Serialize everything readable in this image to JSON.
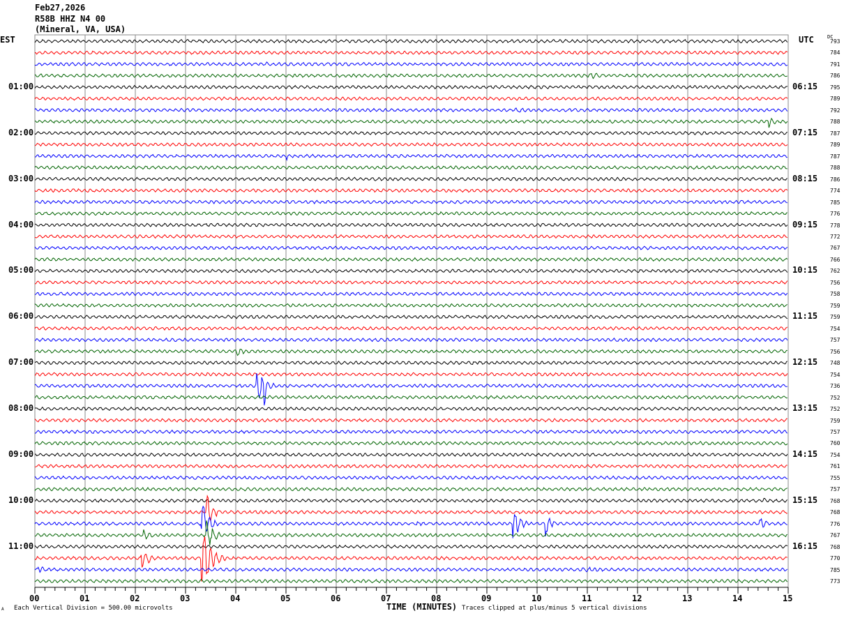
{
  "header": {
    "date": "Feb27,2026",
    "station": "R58B HHZ N4 00",
    "location": "(Mineral, VA, USA)"
  },
  "left_zone": "EST",
  "right_zone": "UTC",
  "dc_label": "DC",
  "footer": {
    "division": "Each Vertical Division =  500.00 microvolts",
    "xlabel": "TIME (MINUTES)",
    "clip": "Traces clipped at plus/minus 5 vertical divisions",
    "corner": "A"
  },
  "chart_data": {
    "type": "line",
    "title": "R58B HHZ N4 00 helicorder",
    "xlabel": "TIME (MINUTES)",
    "xlim": [
      0,
      15
    ],
    "x_ticks": [
      "00",
      "01",
      "02",
      "03",
      "04",
      "05",
      "06",
      "07",
      "08",
      "09",
      "10",
      "11",
      "12",
      "13",
      "14",
      "15"
    ],
    "trace_colors": [
      "#000000",
      "#ff0000",
      "#0000ff",
      "#006400"
    ],
    "trace_count": 48,
    "est_labels": [
      {
        "trace": 4,
        "text": "01:00"
      },
      {
        "trace": 8,
        "text": "02:00"
      },
      {
        "trace": 12,
        "text": "03:00"
      },
      {
        "trace": 16,
        "text": "04:00"
      },
      {
        "trace": 20,
        "text": "05:00"
      },
      {
        "trace": 24,
        "text": "06:00"
      },
      {
        "trace": 28,
        "text": "07:00"
      },
      {
        "trace": 32,
        "text": "08:00"
      },
      {
        "trace": 36,
        "text": "09:00"
      },
      {
        "trace": 40,
        "text": "10:00"
      },
      {
        "trace": 44,
        "text": "11:00"
      }
    ],
    "utc_labels": [
      {
        "trace": 4,
        "text": "06:15"
      },
      {
        "trace": 8,
        "text": "07:15"
      },
      {
        "trace": 12,
        "text": "08:15"
      },
      {
        "trace": 16,
        "text": "09:15"
      },
      {
        "trace": 20,
        "text": "10:15"
      },
      {
        "trace": 24,
        "text": "11:15"
      },
      {
        "trace": 28,
        "text": "12:15"
      },
      {
        "trace": 32,
        "text": "13:15"
      },
      {
        "trace": 36,
        "text": "14:15"
      },
      {
        "trace": 40,
        "text": "15:15"
      },
      {
        "trace": 44,
        "text": "16:15"
      }
    ],
    "dc_offsets": [
      "793",
      "784",
      "791",
      "786",
      "795",
      "789",
      "792",
      "788",
      "787",
      "789",
      "787",
      "788",
      "786",
      "774",
      "785",
      "776",
      "778",
      "772",
      "767",
      "766",
      "762",
      "756",
      "758",
      "759",
      "759",
      "754",
      "757",
      "756",
      "748",
      "754",
      "736",
      "752",
      "752",
      "759",
      "757",
      "760",
      "754",
      "761",
      "755",
      "757",
      "768",
      "768",
      "776",
      "767",
      "768",
      "770",
      "785",
      "773"
    ],
    "events": [
      {
        "trace": 2,
        "minute": 4.6,
        "dur": 0.15,
        "amp": 8
      },
      {
        "trace": 3,
        "minute": 0.1,
        "dur": 0.3,
        "amp": 5
      },
      {
        "trace": 3,
        "minute": 11.0,
        "dur": 1.4,
        "amp": 5
      },
      {
        "trace": 6,
        "minute": 9.5,
        "dur": 1.5,
        "amp": 4
      },
      {
        "trace": 7,
        "minute": 14.6,
        "dur": 0.3,
        "amp": 12
      },
      {
        "trace": 10,
        "minute": 5.0,
        "dur": 0.15,
        "amp": 8
      },
      {
        "trace": 27,
        "minute": 4.0,
        "dur": 0.6,
        "amp": 8
      },
      {
        "trace": 28,
        "minute": 8.7,
        "dur": 0.1,
        "amp": 7
      },
      {
        "trace": 30,
        "minute": 4.4,
        "dur": 0.5,
        "amp": 30
      },
      {
        "trace": 30,
        "minute": 4.55,
        "dur": 0.1,
        "amp": 70
      },
      {
        "trace": 34,
        "minute": 1.15,
        "dur": 0.1,
        "amp": 7
      },
      {
        "trace": 35,
        "minute": 4.95,
        "dur": 0.1,
        "amp": 6
      },
      {
        "trace": 35,
        "minute": 13.2,
        "dur": 0.3,
        "amp": 6
      },
      {
        "trace": 40,
        "minute": 14.5,
        "dur": 0.2,
        "amp": 6
      },
      {
        "trace": 41,
        "minute": 3.4,
        "dur": 0.4,
        "amp": 30
      },
      {
        "trace": 42,
        "minute": 3.3,
        "dur": 0.4,
        "amp": 40
      },
      {
        "trace": 42,
        "minute": 9.5,
        "dur": 0.4,
        "amp": 30
      },
      {
        "trace": 42,
        "minute": 10.15,
        "dur": 0.3,
        "amp": 25
      },
      {
        "trace": 42,
        "minute": 14.4,
        "dur": 0.4,
        "amp": 14
      },
      {
        "trace": 42,
        "minute": 7.5,
        "dur": 2.0,
        "amp": 4
      },
      {
        "trace": 43,
        "minute": 2.15,
        "dur": 0.4,
        "amp": 12
      },
      {
        "trace": 43,
        "minute": 3.4,
        "dur": 0.4,
        "amp": 30
      },
      {
        "trace": 45,
        "minute": 2.1,
        "dur": 0.4,
        "amp": 22
      },
      {
        "trace": 45,
        "minute": 3.3,
        "dur": 0.5,
        "amp": 60
      },
      {
        "trace": 46,
        "minute": 0.05,
        "dur": 0.4,
        "amp": 8
      },
      {
        "trace": 46,
        "minute": 10.8,
        "dur": 2.0,
        "amp": 5
      }
    ]
  }
}
